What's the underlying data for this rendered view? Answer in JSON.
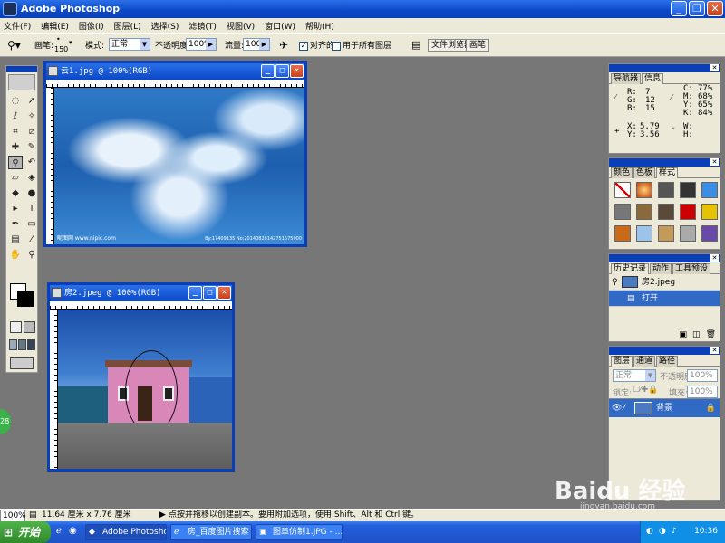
{
  "app": {
    "title": "Adobe Photoshop"
  },
  "menu": [
    "文件(F)",
    "编辑(E)",
    "图像(I)",
    "图层(L)",
    "选择(S)",
    "滤镜(T)",
    "视图(V)",
    "窗口(W)",
    "帮助(H)"
  ],
  "options": {
    "brush_label": "画笔:",
    "brush_size": "150",
    "mode_label": "模式:",
    "mode_value": "正常",
    "opacity_label": "不透明度:",
    "opacity_value": "100%",
    "flow_label": "流量:",
    "flow_value": "100%",
    "aligned_label": "对齐的",
    "all_layers_label": "用于所有图层",
    "well_tabs": [
      "文件浏览器",
      "画笔"
    ]
  },
  "documents": [
    {
      "title": "云1.jpg @ 100%(RGB)",
      "caption_left": "昵图网 www.nipic.com",
      "caption_right": "By:17409135 No:20140828142751575000"
    },
    {
      "title": "房2.jpeg @ 100%(RGB)"
    }
  ],
  "info_panel": {
    "tabs": [
      "导航器",
      "信息"
    ],
    "r": "7",
    "g": "12",
    "b": "15",
    "c": "77%",
    "m": "68%",
    "y": "65%",
    "k": "84%",
    "x": "5.79",
    "y_coord": "3.56",
    "w": "",
    "h": ""
  },
  "styles_panel": {
    "tabs": [
      "颜色",
      "色板",
      "样式"
    ]
  },
  "history_panel": {
    "tabs": [
      "历史记录",
      "动作",
      "工具预设"
    ],
    "snapshot": "房2.jpeg",
    "item": "打开"
  },
  "layers_panel": {
    "tabs": [
      "图层",
      "通道",
      "路径"
    ],
    "mode": "正常",
    "opacity_label": "不透明度:",
    "opacity": "100%",
    "lock_label": "锁定:",
    "fill_label": "填充:",
    "fill": "100%",
    "layer_name": "背景"
  },
  "status": {
    "zoom": "100%",
    "doc_size": "11.64 厘米 x 7.76 厘米",
    "hint": "点按并拖移以创建副本。要用附加选项，使用 Shift、Alt 和 Ctrl 键。"
  },
  "taskbar": {
    "start": "开始",
    "tasks": [
      "Adobe Photoshop",
      "房_百度图片搜索 ...",
      "图章仿制1.JPG - ..."
    ],
    "clock": "10:36"
  },
  "watermark": {
    "main": "Baidu 经验",
    "sub": "jingyan.baidu.com"
  },
  "side_badge": "28"
}
